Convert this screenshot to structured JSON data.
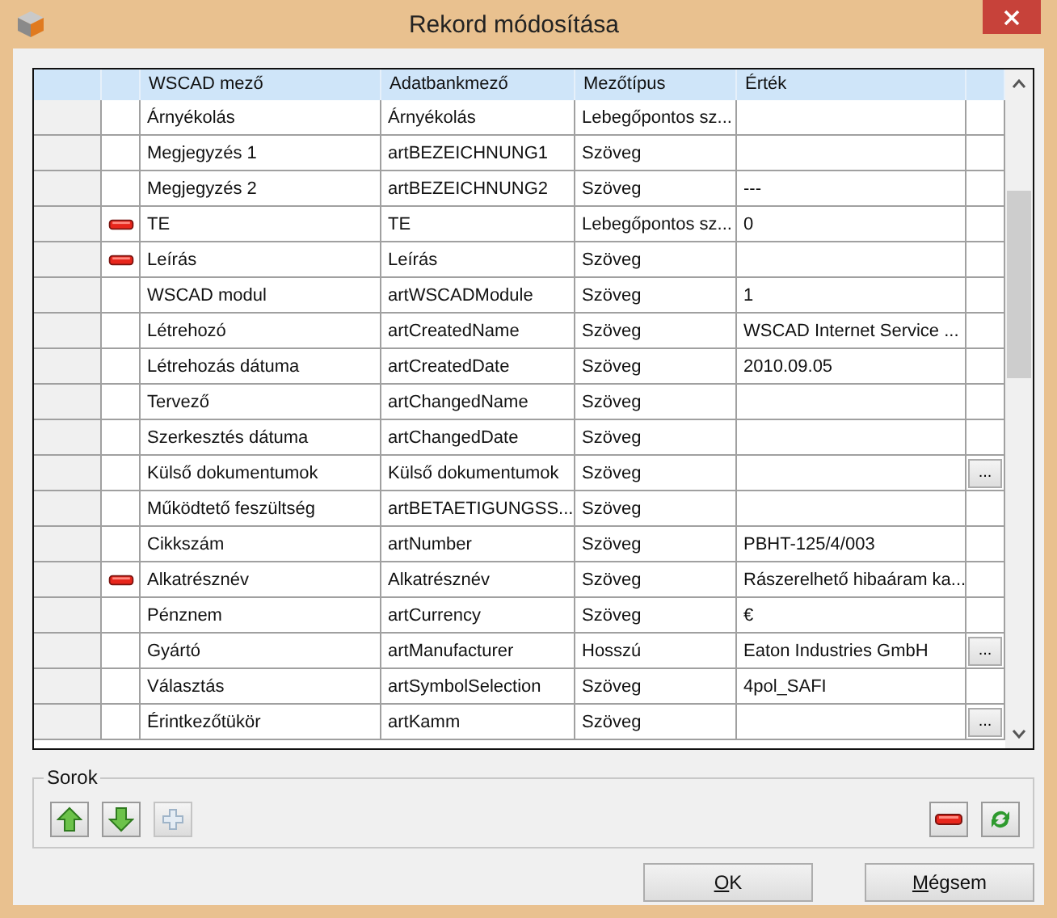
{
  "window": {
    "title": "Rekord módosítása"
  },
  "table": {
    "columns": [
      "WSCAD mező",
      "Adatbankmező",
      "Mezőtípus",
      "Érték"
    ],
    "rows": [
      {
        "wscad_field": "Árnyékolás",
        "db_field": "Árnyékolás",
        "field_type": "Lebegőpontos sz...",
        "value": "",
        "marked": false
      },
      {
        "wscad_field": "Megjegyzés 1",
        "db_field": "artBEZEICHNUNG1",
        "field_type": "Szöveg",
        "value": "",
        "marked": false
      },
      {
        "wscad_field": "Megjegyzés 2",
        "db_field": "artBEZEICHNUNG2",
        "field_type": "Szöveg",
        "value": "---",
        "marked": false
      },
      {
        "wscad_field": "TE",
        "db_field": "TE",
        "field_type": "Lebegőpontos sz...",
        "value": "0",
        "marked": true
      },
      {
        "wscad_field": "Leírás",
        "db_field": "Leírás",
        "field_type": "Szöveg",
        "value": "",
        "marked": true
      },
      {
        "wscad_field": "WSCAD modul",
        "db_field": "artWSCADModule",
        "field_type": "Szöveg",
        "value": "1",
        "marked": false
      },
      {
        "wscad_field": "Létrehozó",
        "db_field": "artCreatedName",
        "field_type": "Szöveg",
        "value": "WSCAD Internet Service ...",
        "marked": false
      },
      {
        "wscad_field": "Létrehozás dátuma",
        "db_field": "artCreatedDate",
        "field_type": "Szöveg",
        "value": "2010.09.05",
        "marked": false
      },
      {
        "wscad_field": "Tervező",
        "db_field": "artChangedName",
        "field_type": "Szöveg",
        "value": "",
        "marked": false
      },
      {
        "wscad_field": "Szerkesztés dátuma",
        "db_field": "artChangedDate",
        "field_type": "Szöveg",
        "value": "",
        "marked": false
      },
      {
        "wscad_field": "Külső dokumentumok",
        "db_field": "Külső dokumentumok",
        "field_type": "Szöveg",
        "value": "",
        "marked": false,
        "browse": "..."
      },
      {
        "wscad_field": "Működtető feszültség",
        "db_field": "artBETAETIGUNGSS...",
        "field_type": "Szöveg",
        "value": "",
        "marked": false
      },
      {
        "wscad_field": "Cikkszám",
        "db_field": "artNumber",
        "field_type": "Szöveg",
        "value": "PBHT-125/4/003",
        "marked": false
      },
      {
        "wscad_field": "Alkatrésznév",
        "db_field": "Alkatrésznév",
        "field_type": "Szöveg",
        "value": "Rászerelhető hibaáram ka...",
        "marked": true
      },
      {
        "wscad_field": "Pénznem",
        "db_field": "artCurrency",
        "field_type": "Szöveg",
        "value": "€",
        "marked": false
      },
      {
        "wscad_field": "Gyártó",
        "db_field": "artManufacturer",
        "field_type": "Hosszú",
        "value": "Eaton Industries GmbH",
        "marked": false,
        "browse": "..."
      },
      {
        "wscad_field": "Választás",
        "db_field": "artSymbolSelection",
        "field_type": "Szöveg",
        "value": "4pol_SAFI",
        "marked": false
      },
      {
        "wscad_field": "Érintkezőtükör",
        "db_field": "artKamm",
        "field_type": "Szöveg",
        "value": "",
        "marked": false,
        "browse": "..."
      }
    ]
  },
  "rows_group": {
    "title": "Sorok",
    "buttons": [
      {
        "kind": "up",
        "disabled": false
      },
      {
        "kind": "down",
        "disabled": false
      },
      {
        "kind": "add",
        "disabled": true
      },
      {
        "kind": "remove",
        "disabled": false
      },
      {
        "kind": "refresh",
        "disabled": false
      }
    ]
  },
  "buttons": [
    {
      "label": "OK",
      "underline_first": true
    },
    {
      "label": "Mégsem",
      "underline_first": true
    }
  ]
}
